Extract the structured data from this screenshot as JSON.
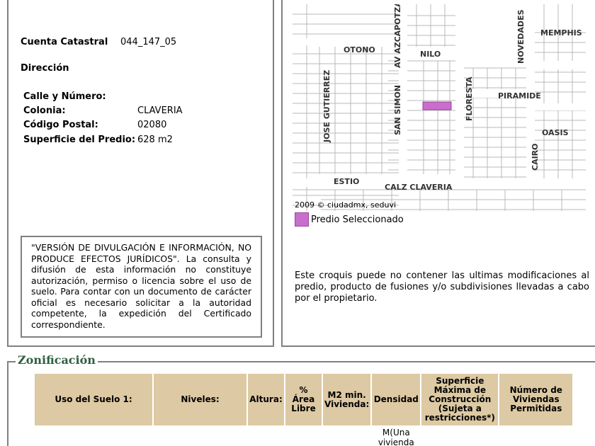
{
  "predio": {
    "cuenta_label": "Cuenta Catastral",
    "cuenta_value": "044_147_05",
    "direccion_label": "Dirección",
    "calle_label": "Calle y Número:",
    "calle_value": "",
    "colonia_label": "Colonia:",
    "colonia_value": "CLAVERIA",
    "cp_label": "Código Postal:",
    "cp_value": "02080",
    "superficie_label": "Superficie del Predio:",
    "superficie_value": "628 m2"
  },
  "disclaimer": "\"VERSIÓN DE DIVULGACIÓN E INFORMACIÓN, NO PRODUCE EFECTOS JURÍDICOS\". La consulta y difusión de esta información no constituye autorización, permiso o licencia sobre el uso de suelo. Para contar con un documento de carácter oficial es necesario solicitar a la autoridad competente, la expedición del Certificado correspondiente.",
  "map": {
    "streets": [
      "OTONO",
      "NILO",
      "AV AZCAPOTZA",
      "NOVEDADES",
      "MEMPHIS",
      "JOSE GUTIERREZ",
      "SAN SIMON",
      "FLORESTA",
      "PIRAMIDE",
      "OASIS",
      "CAIRO",
      "ESTIO",
      "CALZ CLAVERIA"
    ],
    "copyright": "2009 © ciudadmx, seduvi",
    "legend_label": "Predio Seleccionado",
    "highlight_color": "#c86ecd"
  },
  "croquis_note": "Este croquis puede no contener las ultimas modificaciones al predio, producto de fusiones y/o subdivisiones llevadas a cabo por el propietario.",
  "zonificacion": {
    "title": "Zonificación",
    "headers": [
      "Uso del Suelo 1:",
      "Niveles:",
      "Altura:",
      "% Área Libre",
      "M2 min. Vivienda:",
      "Densidad",
      "Superficie Máxima de Construcción (Sujeta a restricciones*)",
      "Número de Viviendas Permitidas"
    ],
    "row_densidad": "M(Una vivienda"
  }
}
